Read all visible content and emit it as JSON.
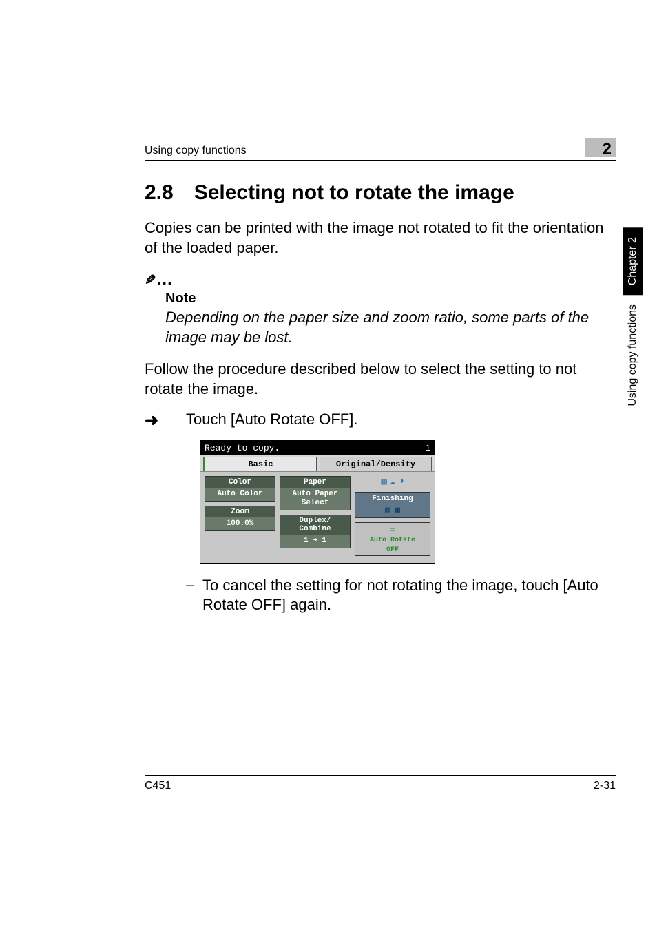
{
  "header": {
    "running_head": "Using copy functions",
    "chapter_badge": "2"
  },
  "section": {
    "number": "2.8",
    "title": "Selecting not to rotate the image"
  },
  "intro": "Copies can be printed with the image not rotated to fit the orientation of the loaded paper.",
  "note": {
    "symbol": "✎",
    "dots": "…",
    "label": "Note",
    "text": "Depending on the paper size and zoom ratio, some parts of the image may be lost."
  },
  "follow": "Follow the procedure described below to select the setting to not rotate the image.",
  "step": {
    "arrow": "➜",
    "text": "Touch [Auto Rotate OFF]."
  },
  "lcd": {
    "status_left": "Ready to copy.",
    "status_right": "1",
    "tab_basic": "Basic",
    "tab_orig": "Original/Density",
    "color_h": "Color",
    "color_v": "Auto Color",
    "paper_h": "Paper",
    "paper_v": "Auto Paper\nSelect",
    "zoom_h": "Zoom",
    "zoom_v": "100.0%",
    "duplex_h": "Duplex/\nCombine",
    "duplex_v": "1 ➜ 1",
    "finishing_h": "Finishing",
    "rotate_label": "Auto Rotate",
    "rotate_off": "OFF"
  },
  "substep": {
    "bullet": "–",
    "text": "To cancel the setting for not rotating the image, touch [Auto Rotate OFF] again."
  },
  "side": {
    "chapter": "Chapter 2",
    "label": "Using copy functions"
  },
  "footer": {
    "left": "C451",
    "right": "2-31"
  }
}
